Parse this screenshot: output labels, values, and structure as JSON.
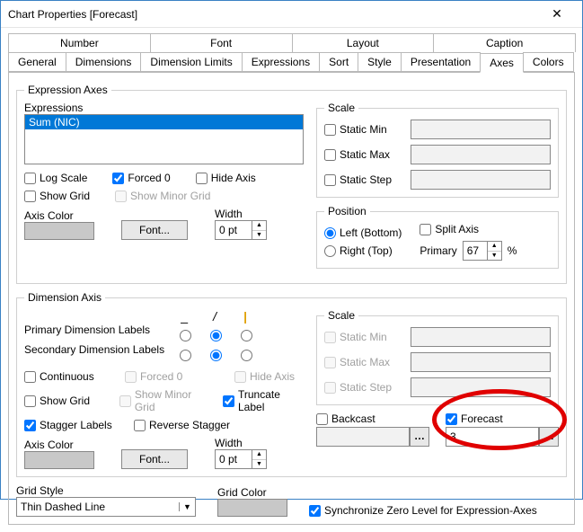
{
  "title": "Chart Properties [Forecast]",
  "tabsTop": {
    "t0": "Number",
    "t1": "Font",
    "t2": "Layout",
    "t3": "Caption"
  },
  "tabsBottom": {
    "t0": "General",
    "t1": "Dimensions",
    "t2": "Dimension Limits",
    "t3": "Expressions",
    "t4": "Sort",
    "t5": "Style",
    "t6": "Presentation",
    "t7": "Axes",
    "t8": "Colors"
  },
  "exprAxes": {
    "legend": "Expression Axes",
    "exprLabel": "Expressions",
    "item0": "Sum (NIC)",
    "logScale": "Log Scale",
    "forced0": "Forced 0",
    "hideAxis": "Hide Axis",
    "showGrid": "Show Grid",
    "showMinorGrid": "Show Minor Grid",
    "axisColor": "Axis Color",
    "fontBtn": "Font...",
    "widthLabel": "Width",
    "widthVal": "0 pt",
    "scale": {
      "legend": "Scale",
      "staticMin": "Static Min",
      "staticMax": "Static Max",
      "staticStep": "Static Step"
    },
    "position": {
      "legend": "Position",
      "left": "Left (Bottom)",
      "right": "Right (Top)",
      "splitAxis": "Split Axis",
      "primary": "Primary",
      "primaryVal": "67",
      "pct": "%"
    }
  },
  "dimAxis": {
    "legend": "Dimension Axis",
    "primaryLbl": "Primary Dimension Labels",
    "secondaryLbl": "Secondary Dimension Labels",
    "tickHdr0": "_",
    "tickHdr1": "/",
    "tickHdr2": "|",
    "continuous": "Continuous",
    "forced0": "Forced 0",
    "hideAxis": "Hide Axis",
    "showGrid": "Show Grid",
    "showMinorGrid": "Show Minor Grid",
    "truncateLabel": "Truncate Label",
    "staggerLabels": "Stagger Labels",
    "reverseStagger": "Reverse Stagger",
    "axisColor": "Axis Color",
    "fontBtn": "Font...",
    "widthLabel": "Width",
    "widthVal": "0 pt",
    "scale": {
      "legend": "Scale",
      "staticMin": "Static Min",
      "staticMax": "Static Max",
      "staticStep": "Static Step"
    },
    "backcast": "Backcast",
    "forecast": "Forecast",
    "forecastVal": "3"
  },
  "gridStyleLabel": "Grid Style",
  "gridStyleVal": "Thin Dashed Line",
  "gridColorLabel": "Grid Color",
  "syncZero": "Synchronize Zero Level for Expression-Axes"
}
